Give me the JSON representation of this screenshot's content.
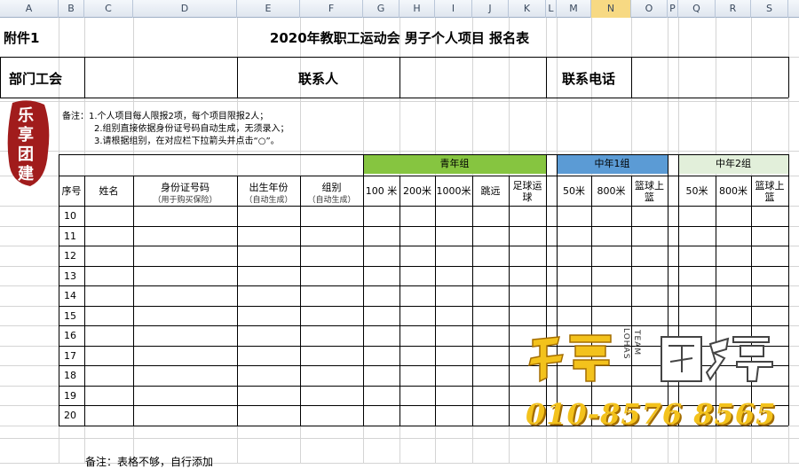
{
  "columns": [
    "A",
    "B",
    "C",
    "D",
    "E",
    "F",
    "G",
    "H",
    "I",
    "J",
    "K",
    "L",
    "M",
    "N",
    "O",
    "P",
    "Q",
    "R",
    "S"
  ],
  "attachment_label": "附件1",
  "title": "2020年教职工运动会  男子个人项目  报名表",
  "dept_label": "部门工会",
  "contact_label": "联系人",
  "phone_label": "联系电话",
  "note_line1": "备注：1.个人项目每人限报2项，每个项目限报2人；",
  "note_line2": "2.组别直接依据身份证号码自动生成，无须录入；",
  "note_line3": "3.请根据组别，在对应栏下拉箭头并点击“○”。",
  "group_youth": "青年组",
  "group_mid1": "中年1组",
  "group_mid2": "中年2组",
  "headers": {
    "seq": "序号",
    "name": "姓名",
    "id": "身份证号码",
    "id_sub": "（用于购买保险）",
    "birth": "出生年份",
    "birth_sub": "（自动生成）",
    "group": "组别",
    "group_sub": "（自动生成）",
    "y100": "100 米",
    "y200": "200米",
    "y1000": "1000米",
    "yjump": "跳远",
    "yfoot": "足球运球",
    "m1_50": "50米",
    "m1_800": "800米",
    "m1_bb": "篮球上篮",
    "m2_50": "50米",
    "m2_800": "800米",
    "m2_bb": "篮球上篮"
  },
  "rows": [
    "10",
    "11",
    "12",
    "13",
    "14",
    "15",
    "16",
    "17",
    "18",
    "19",
    "20"
  ],
  "footer_note": "备注：表格不够，自行添加",
  "watermark": {
    "logo_text": "乐享团建",
    "lohas": "LOHAS",
    "team": "TEAM",
    "phone": "010-8576 8565"
  },
  "signature_text": "乐享团建",
  "colors": {
    "youth": "#86c540",
    "mid1": "#5b9bd5",
    "mid2": "#e2efda",
    "selected_col": "#f7d983",
    "watermark": "#f3c21c"
  }
}
